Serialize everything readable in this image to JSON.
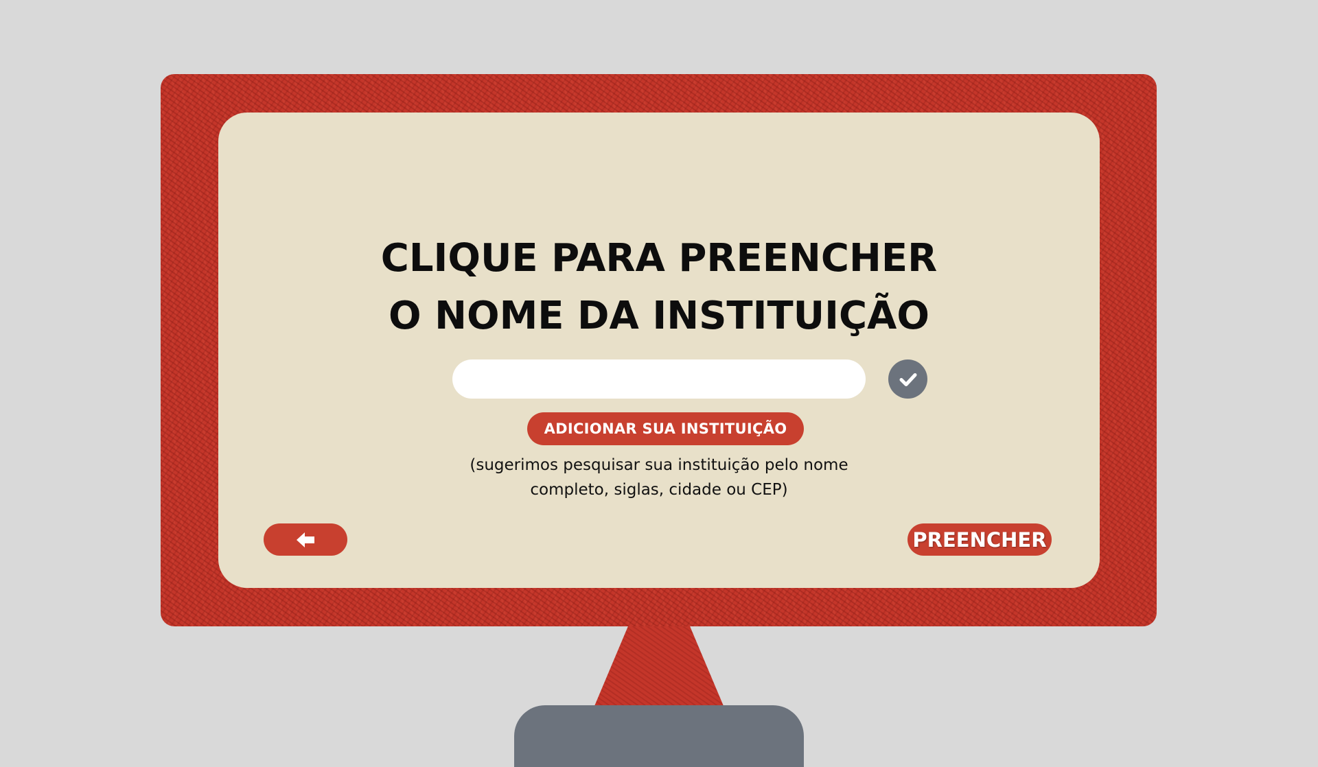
{
  "title": {
    "line1": "CLIQUE PARA PREENCHER",
    "line2": "O NOME DA INSTITUIÇÃO"
  },
  "search": {
    "value": "",
    "placeholder": ""
  },
  "confirm": {
    "icon": "check-icon"
  },
  "add_institution": {
    "label": "ADICIONAR SUA INSTITUIÇÃO"
  },
  "hint": {
    "line1": "(sugerimos pesquisar sua instituição pelo nome",
    "line2": "completo, siglas, cidade ou CEP)"
  },
  "navigation": {
    "back_icon": "arrow-left-icon",
    "fill_label": "PREENCHER"
  },
  "colors": {
    "background": "#d9d9d9",
    "frame": "#c4362a",
    "screen": "#e8e0c9",
    "accent": "#c8402f",
    "confirm": "#6c737d",
    "stand": "#6c737d"
  }
}
